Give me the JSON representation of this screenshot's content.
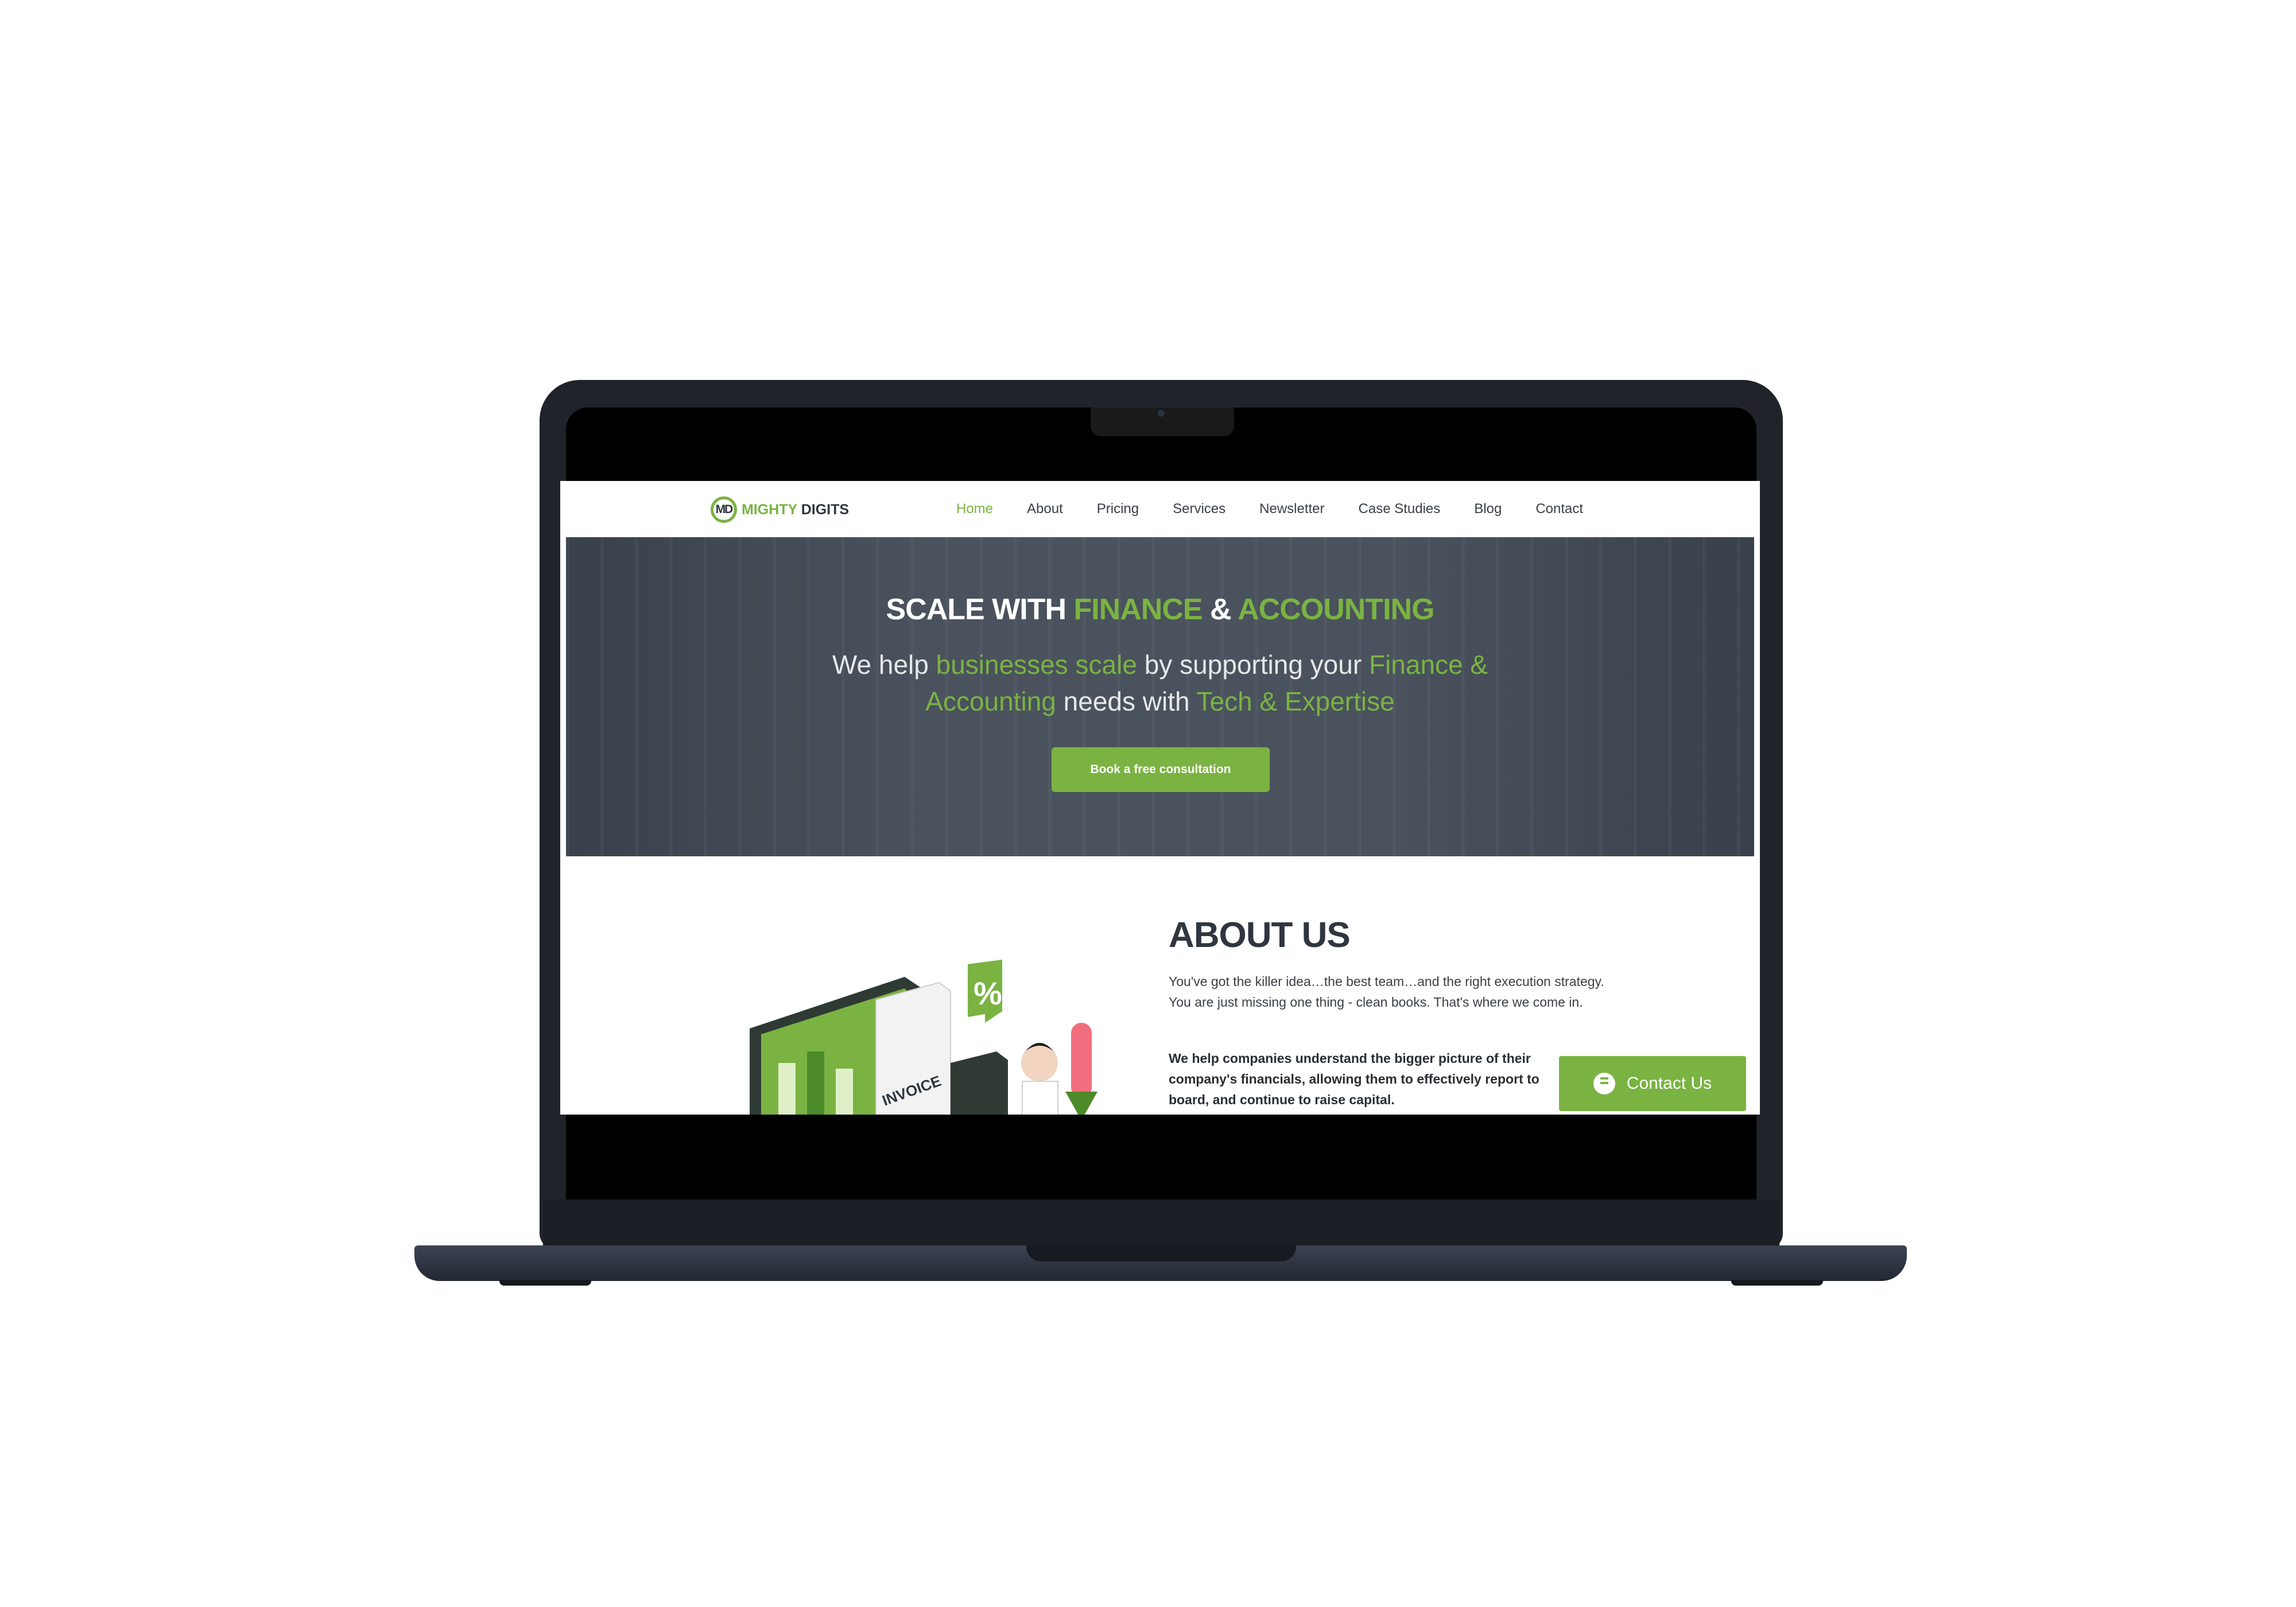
{
  "site": {
    "logo": {
      "mark": "MD",
      "word1": "MIGHTY",
      "word2": "DIGITS"
    },
    "nav": [
      "Home",
      "About",
      "Pricing",
      "Services",
      "Newsletter",
      "Case Studies",
      "Blog",
      "Contact"
    ],
    "active_nav": "Home"
  },
  "hero": {
    "title_part1": "SCALE WITH ",
    "title_hl1": "FINANCE",
    "title_part2": " & ",
    "title_hl2": "ACCOUNTING",
    "sub_part1": "We help ",
    "sub_hl1": "businesses scale",
    "sub_part2": " by supporting your ",
    "sub_hl2": "Finance & Accounting",
    "sub_part3": " needs with ",
    "sub_hl3": "Tech & Expertise",
    "cta_label": "Book a free consultation"
  },
  "about": {
    "title": "ABOUT US",
    "paragraph1": "You've got the killer idea…the best team…and the right execution strategy. You are just missing one thing - clean books. That's where we come in.",
    "paragraph2": "We help companies understand the bigger picture of their company's financials, allowing them to effectively report to board, and continue to raise capital.",
    "illustration": {
      "percent_sign": "%",
      "invoice_label": "INVOICE"
    }
  },
  "chat_widget": {
    "label": "Contact Us",
    "icon": "chat-bubble-icon"
  },
  "colors": {
    "accent": "#7ab342",
    "dark_text": "#2f3640",
    "hero_bg": "#4a525d",
    "laptop": "#20232a"
  }
}
